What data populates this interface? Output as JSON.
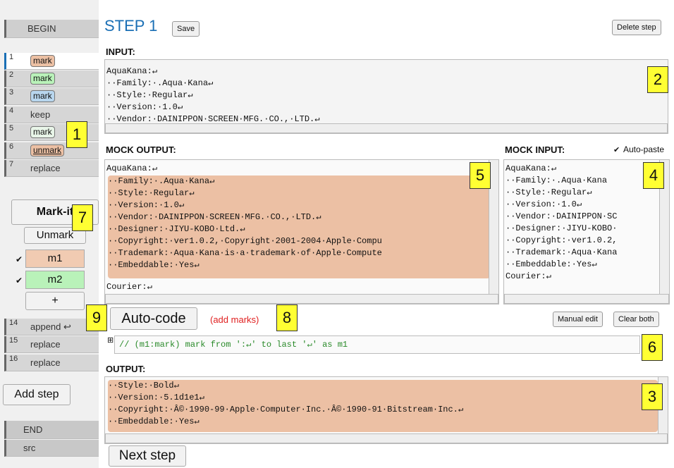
{
  "sidebar": {
    "begin": "BEGIN",
    "steps": [
      {
        "num": "1",
        "label": "mark",
        "style": "pill",
        "color": "#ecc0a4"
      },
      {
        "num": "2",
        "label": "mark",
        "style": "pill",
        "color": "#b9f2b9"
      },
      {
        "num": "3",
        "label": "mark",
        "style": "pill",
        "color": "#b8d6ee"
      },
      {
        "num": "4",
        "label": "keep",
        "style": "text"
      },
      {
        "num": "5",
        "label": "mark",
        "style": "pill",
        "color": "#e8f5e8"
      },
      {
        "num": "6",
        "label": "unmark",
        "style": "pill-u",
        "color": "#ecc0a4"
      },
      {
        "num": "7",
        "label": "replace",
        "style": "text"
      },
      {
        "num": "14",
        "label": "append ↩",
        "style": "text"
      },
      {
        "num": "15",
        "label": "replace",
        "style": "text"
      },
      {
        "num": "16",
        "label": "replace",
        "style": "text"
      }
    ],
    "markit_label": "Mark-it",
    "unmark_label": "Unmark",
    "marks": [
      {
        "checked": "✔",
        "label": "m1",
        "color": "#f1cbb2"
      },
      {
        "checked": "✔",
        "label": "m2",
        "color": "#b9f2b9"
      }
    ],
    "plus_label": "+",
    "add_step": "Add step",
    "end": "END",
    "src": "src"
  },
  "header": {
    "title": "STEP 1",
    "save": "Save",
    "delete_step": "Delete step"
  },
  "input": {
    "title": "INPUT:",
    "lines": [
      "AquaKana:↵",
      "··Family:·.Aqua·Kana↵",
      "··Style:·Regular↵",
      "··Version:·1.0↵",
      "··Vendor:·DAINIPPON·SCREEN·MFG.·CO.,·LTD.↵"
    ]
  },
  "mock_output": {
    "title": "MOCK OUTPUT:",
    "first": "AquaKana:↵",
    "highlighted": [
      "··Family:·.Aqua·Kana↵",
      "··Style:·Regular↵",
      "··Version:·1.0↵",
      "··Vendor:·DAINIPPON·SCREEN·MFG.·CO.,·LTD.↵",
      "··Designer:·JIYU-KOBO·Ltd.↵",
      "··Copyright:·ver1.0.2,·Copyright·2001-2004·Apple·Compu",
      "··Trademark:·Aqua·Kana·is·a·trademark·of·Apple·Compute",
      "··Embeddable:·Yes↵"
    ],
    "last": "Courier:↵"
  },
  "mock_input": {
    "title": "MOCK INPUT:",
    "autopaste_check": "✔",
    "autopaste_label": "Auto-paste",
    "lines": [
      "AquaKana:↵",
      "··Family:·.Aqua·Kana",
      "··Style:·Regular↵",
      "··Version:·1.0↵",
      "··Vendor:·DAINIPPON·SC",
      "··Designer:·JIYU-KOBO·",
      "··Copyright:·ver1.0.2,",
      "··Trademark:·Aqua·Kana",
      "··Embeddable:·Yes↵",
      "Courier:↵"
    ]
  },
  "code": {
    "autocode": "Auto-code",
    "add_marks": "(add marks)",
    "manual_edit": "Manual edit",
    "clear_both": "Clear both",
    "expander": "⊞",
    "line": "// (m1:mark) mark from ':↵' to last '↵' as m1"
  },
  "output": {
    "title": "OUTPUT:",
    "lines": [
      "··Style:·Bold↵",
      "··Version:·5.1d1e1↵",
      "··Copyright:·Â©·1990-99·Apple·Computer·Inc.·Â©·1990-91·Bitstream·Inc.↵",
      "··Embeddable:·Yes↵"
    ]
  },
  "next_step": "Next step",
  "callouts": [
    "1",
    "2",
    "3",
    "4",
    "5",
    "6",
    "7",
    "8",
    "9"
  ],
  "colors": {
    "title_blue": "#1a6fb5",
    "highlight": "#ecc0a4",
    "callout_yellow": "#ffff33",
    "red_note": "#e02020"
  }
}
